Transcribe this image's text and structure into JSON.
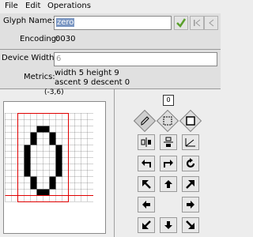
{
  "menu": {
    "file": "File",
    "edit": "Edit",
    "operations": "Operations"
  },
  "glyph": {
    "name_label": "Glyph Name:",
    "name_value": "zero",
    "encoding_label": "Encoding:",
    "encoding_value": "0030"
  },
  "device": {
    "width_label": "Device Width:",
    "width_value": "6",
    "metrics_label": "Metrics:",
    "metrics_line1": "width 5 height 9",
    "metrics_line2": "ascent 9 descent 0"
  },
  "canvas": {
    "coords": "(-3,6)"
  },
  "tools": {
    "value_box": "0"
  },
  "icons": {
    "apply": "checkmark-icon",
    "first": "first-glyph-icon",
    "prev": "prev-glyph-icon",
    "next": "next-glyph-icon"
  },
  "bitmap": {
    "cols": 14,
    "rows": 14,
    "pixels": [
      [
        5,
        2
      ],
      [
        6,
        2
      ],
      [
        4,
        3
      ],
      [
        7,
        3
      ],
      [
        4,
        4
      ],
      [
        7,
        4
      ],
      [
        3,
        5
      ],
      [
        8,
        5
      ],
      [
        3,
        6
      ],
      [
        8,
        6
      ],
      [
        3,
        7
      ],
      [
        8,
        7
      ],
      [
        3,
        8
      ],
      [
        8,
        8
      ],
      [
        3,
        9
      ],
      [
        8,
        9
      ],
      [
        4,
        10
      ],
      [
        7,
        10
      ],
      [
        4,
        11
      ],
      [
        7,
        11
      ],
      [
        5,
        12
      ],
      [
        6,
        12
      ]
    ]
  },
  "colors": {
    "grid": "#555555",
    "bbox": "#e00000",
    "pixel": "#000000",
    "selection": "#7a96c2"
  }
}
